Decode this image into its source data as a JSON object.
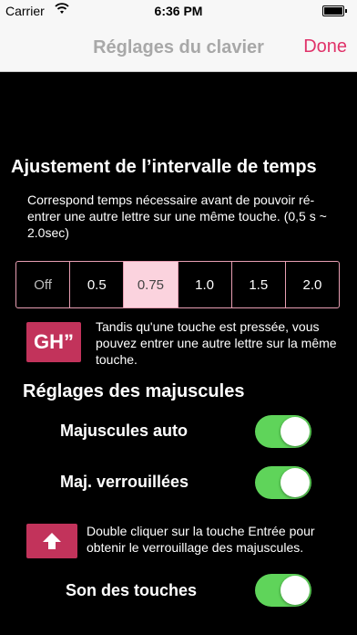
{
  "status": {
    "carrier": "Carrier",
    "time": "6:36 PM"
  },
  "nav": {
    "title": "Réglages du clavier",
    "done": "Done"
  },
  "interval": {
    "title": "Ajustement de l’intervalle de temps",
    "description": "Correspond temps nécessaire avant de pouvoir ré-entrer une autre lettre sur une même touche. (0,5 s ~ 2.0sec)",
    "options": [
      "Off",
      "0.5",
      "0.75",
      "1.0",
      "1.5",
      "2.0"
    ],
    "selected": "0.75",
    "icon_text": "GH”",
    "info": "Tandis qu'une touche est pressée, vous pouvez entrer une autre lettre sur la même touche."
  },
  "caps": {
    "title": "Réglages des majuscules",
    "auto_label": "Majuscules auto",
    "auto_on": true,
    "lock_label": "Maj. verrouillées",
    "lock_on": true,
    "info": "Double cliquer sur la touche Entrée pour obtenir le verrouillage des majuscules."
  },
  "sound": {
    "label": "Son des touches",
    "on": true
  },
  "colors": {
    "accent": "#e0336a",
    "icon_bg": "#c2335b",
    "toggle_on": "#5fd45a",
    "segment_selected": "#fbd3de"
  },
  "icons": [
    "wifi-icon",
    "battery-icon",
    "arrow-up-icon"
  ]
}
